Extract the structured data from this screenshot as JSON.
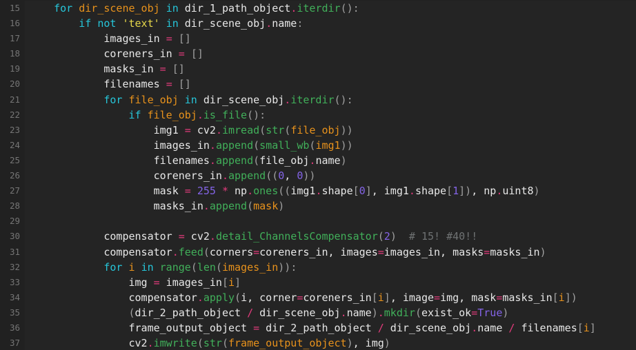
{
  "editor": {
    "language": "python",
    "theme": "dark",
    "background_color": "#212121",
    "gutter_color": "#212121",
    "code_background_color": "#242424",
    "first_line_number": 15,
    "last_line_number": 37,
    "colors": {
      "keyword": "#26c6da",
      "function": "#41b05a",
      "variable": "#e8921c",
      "number": "#8464e8",
      "string": "#e6d74a",
      "operator": "#e33b7c",
      "punctuation": "#a0a0a0",
      "comment": "#6f7273",
      "plain": "#e8e8e8",
      "lineno": "#757575"
    }
  },
  "lines": [
    {
      "number": "15",
      "text": "    for dir_scene_obj in dir_1_path_object.iterdir():",
      "tokens": [
        {
          "t": "    ",
          "c": "pl"
        },
        {
          "t": "for",
          "c": "kw"
        },
        {
          "t": " ",
          "c": "pl"
        },
        {
          "t": "dir_scene_obj",
          "c": "var"
        },
        {
          "t": " ",
          "c": "pl"
        },
        {
          "t": "in",
          "c": "kw"
        },
        {
          "t": " dir_1_path_object",
          "c": "pl"
        },
        {
          "t": ".",
          "c": "op"
        },
        {
          "t": "iterdir",
          "c": "fn"
        },
        {
          "t": "()",
          "c": "pn"
        },
        {
          "t": ":",
          "c": "pn"
        }
      ]
    },
    {
      "number": "16",
      "text": "        if not 'text' in dir_scene_obj.name:",
      "tokens": [
        {
          "t": "        ",
          "c": "pl"
        },
        {
          "t": "if",
          "c": "kw"
        },
        {
          "t": " ",
          "c": "pl"
        },
        {
          "t": "not",
          "c": "kw"
        },
        {
          "t": " ",
          "c": "pl"
        },
        {
          "t": "'text'",
          "c": "str"
        },
        {
          "t": " ",
          "c": "pl"
        },
        {
          "t": "in",
          "c": "kw"
        },
        {
          "t": " dir_scene_obj",
          "c": "pl"
        },
        {
          "t": ".",
          "c": "op"
        },
        {
          "t": "name",
          "c": "pl"
        },
        {
          "t": ":",
          "c": "pn"
        }
      ]
    },
    {
      "number": "17",
      "text": "            images_in = []",
      "tokens": [
        {
          "t": "            images_in",
          "c": "pl"
        },
        {
          "t": " ",
          "c": "pl"
        },
        {
          "t": "=",
          "c": "op"
        },
        {
          "t": " ",
          "c": "pl"
        },
        {
          "t": "[]",
          "c": "pn"
        }
      ]
    },
    {
      "number": "18",
      "text": "            coreners_in = []",
      "tokens": [
        {
          "t": "            coreners_in",
          "c": "pl"
        },
        {
          "t": " ",
          "c": "pl"
        },
        {
          "t": "=",
          "c": "op"
        },
        {
          "t": " ",
          "c": "pl"
        },
        {
          "t": "[]",
          "c": "pn"
        }
      ]
    },
    {
      "number": "19",
      "text": "            masks_in = []",
      "tokens": [
        {
          "t": "            masks_in",
          "c": "pl"
        },
        {
          "t": " ",
          "c": "pl"
        },
        {
          "t": "=",
          "c": "op"
        },
        {
          "t": " ",
          "c": "pl"
        },
        {
          "t": "[]",
          "c": "pn"
        }
      ]
    },
    {
      "number": "20",
      "text": "            filenames = []",
      "tokens": [
        {
          "t": "            filenames",
          "c": "pl"
        },
        {
          "t": " ",
          "c": "pl"
        },
        {
          "t": "=",
          "c": "op"
        },
        {
          "t": " ",
          "c": "pl"
        },
        {
          "t": "[]",
          "c": "pn"
        }
      ]
    },
    {
      "number": "21",
      "text": "            for file_obj in dir_scene_obj.iterdir():",
      "tokens": [
        {
          "t": "            ",
          "c": "pl"
        },
        {
          "t": "for",
          "c": "kw"
        },
        {
          "t": " ",
          "c": "pl"
        },
        {
          "t": "file_obj",
          "c": "var"
        },
        {
          "t": " ",
          "c": "pl"
        },
        {
          "t": "in",
          "c": "kw"
        },
        {
          "t": " dir_scene_obj",
          "c": "pl"
        },
        {
          "t": ".",
          "c": "op"
        },
        {
          "t": "iterdir",
          "c": "fn"
        },
        {
          "t": "()",
          "c": "pn"
        },
        {
          "t": ":",
          "c": "pn"
        }
      ]
    },
    {
      "number": "22",
      "text": "                if file_obj.is_file():",
      "tokens": [
        {
          "t": "                ",
          "c": "pl"
        },
        {
          "t": "if",
          "c": "kw"
        },
        {
          "t": " ",
          "c": "pl"
        },
        {
          "t": "file_obj",
          "c": "var"
        },
        {
          "t": ".",
          "c": "op"
        },
        {
          "t": "is_file",
          "c": "fn"
        },
        {
          "t": "()",
          "c": "pn"
        },
        {
          "t": ":",
          "c": "pn"
        }
      ]
    },
    {
      "number": "23",
      "text": "                    img1 = cv2.imread(str(file_obj))",
      "tokens": [
        {
          "t": "                    img1",
          "c": "pl"
        },
        {
          "t": " ",
          "c": "pl"
        },
        {
          "t": "=",
          "c": "op"
        },
        {
          "t": " cv2",
          "c": "pl"
        },
        {
          "t": ".",
          "c": "op"
        },
        {
          "t": "imread",
          "c": "fn"
        },
        {
          "t": "(",
          "c": "pn"
        },
        {
          "t": "str",
          "c": "fn"
        },
        {
          "t": "(",
          "c": "pn"
        },
        {
          "t": "file_obj",
          "c": "var"
        },
        {
          "t": "))",
          "c": "pn"
        }
      ]
    },
    {
      "number": "24",
      "text": "                    images_in.append(small_wb(img1))",
      "tokens": [
        {
          "t": "                    images_in",
          "c": "pl"
        },
        {
          "t": ".",
          "c": "op"
        },
        {
          "t": "append",
          "c": "fn"
        },
        {
          "t": "(",
          "c": "pn"
        },
        {
          "t": "small_wb",
          "c": "fn"
        },
        {
          "t": "(",
          "c": "pn"
        },
        {
          "t": "img1",
          "c": "var"
        },
        {
          "t": "))",
          "c": "pn"
        }
      ]
    },
    {
      "number": "25",
      "text": "                    filenames.append(file_obj.name)",
      "tokens": [
        {
          "t": "                    filenames",
          "c": "pl"
        },
        {
          "t": ".",
          "c": "op"
        },
        {
          "t": "append",
          "c": "fn"
        },
        {
          "t": "(",
          "c": "pn"
        },
        {
          "t": "file_obj",
          "c": "pl"
        },
        {
          "t": ".",
          "c": "op"
        },
        {
          "t": "name",
          "c": "pl"
        },
        {
          "t": ")",
          "c": "pn"
        }
      ]
    },
    {
      "number": "26",
      "text": "                    coreners_in.append((0, 0))",
      "tokens": [
        {
          "t": "                    coreners_in",
          "c": "pl"
        },
        {
          "t": ".",
          "c": "op"
        },
        {
          "t": "append",
          "c": "fn"
        },
        {
          "t": "((",
          "c": "pn"
        },
        {
          "t": "0",
          "c": "num"
        },
        {
          "t": ", ",
          "c": "pl"
        },
        {
          "t": "0",
          "c": "num"
        },
        {
          "t": "))",
          "c": "pn"
        }
      ]
    },
    {
      "number": "27",
      "text": "                    mask = 255 * np.ones((img1.shape[0], img1.shape[1]), np.uint8)",
      "tokens": [
        {
          "t": "                    mask",
          "c": "pl"
        },
        {
          "t": " ",
          "c": "pl"
        },
        {
          "t": "=",
          "c": "op"
        },
        {
          "t": " ",
          "c": "pl"
        },
        {
          "t": "255",
          "c": "num"
        },
        {
          "t": " ",
          "c": "pl"
        },
        {
          "t": "*",
          "c": "op"
        },
        {
          "t": " np",
          "c": "pl"
        },
        {
          "t": ".",
          "c": "op"
        },
        {
          "t": "ones",
          "c": "fn"
        },
        {
          "t": "((",
          "c": "pn"
        },
        {
          "t": "img1",
          "c": "pl"
        },
        {
          "t": ".",
          "c": "op"
        },
        {
          "t": "shape",
          "c": "pl"
        },
        {
          "t": "[",
          "c": "pn"
        },
        {
          "t": "0",
          "c": "num"
        },
        {
          "t": "]",
          "c": "pn"
        },
        {
          "t": ", img1",
          "c": "pl"
        },
        {
          "t": ".",
          "c": "op"
        },
        {
          "t": "shape",
          "c": "pl"
        },
        {
          "t": "[",
          "c": "pn"
        },
        {
          "t": "1",
          "c": "num"
        },
        {
          "t": "])",
          "c": "pn"
        },
        {
          "t": ", np",
          "c": "pl"
        },
        {
          "t": ".",
          "c": "op"
        },
        {
          "t": "uint8",
          "c": "pl"
        },
        {
          "t": ")",
          "c": "pn"
        }
      ]
    },
    {
      "number": "28",
      "text": "                    masks_in.append(mask)",
      "tokens": [
        {
          "t": "                    masks_in",
          "c": "pl"
        },
        {
          "t": ".",
          "c": "op"
        },
        {
          "t": "append",
          "c": "fn"
        },
        {
          "t": "(",
          "c": "pn"
        },
        {
          "t": "mask",
          "c": "var"
        },
        {
          "t": ")",
          "c": "pn"
        }
      ]
    },
    {
      "number": "29",
      "text": "",
      "tokens": []
    },
    {
      "number": "30",
      "text": "            compensator = cv2.detail_ChannelsCompensator(2)  # 15! #40!!",
      "tokens": [
        {
          "t": "            compensator",
          "c": "pl"
        },
        {
          "t": " ",
          "c": "pl"
        },
        {
          "t": "=",
          "c": "op"
        },
        {
          "t": " cv2",
          "c": "pl"
        },
        {
          "t": ".",
          "c": "op"
        },
        {
          "t": "detail_ChannelsCompensator",
          "c": "fn"
        },
        {
          "t": "(",
          "c": "pn"
        },
        {
          "t": "2",
          "c": "num"
        },
        {
          "t": ")",
          "c": "pn"
        },
        {
          "t": "  ",
          "c": "pl"
        },
        {
          "t": "# 15! #40!!",
          "c": "cmt"
        }
      ]
    },
    {
      "number": "31",
      "text": "            compensator.feed(corners=coreners_in, images=images_in, masks=masks_in)",
      "tokens": [
        {
          "t": "            compensator",
          "c": "pl"
        },
        {
          "t": ".",
          "c": "op"
        },
        {
          "t": "feed",
          "c": "fn"
        },
        {
          "t": "(",
          "c": "pn"
        },
        {
          "t": "corners",
          "c": "pl"
        },
        {
          "t": "=",
          "c": "op"
        },
        {
          "t": "coreners_in, images",
          "c": "pl"
        },
        {
          "t": "=",
          "c": "op"
        },
        {
          "t": "images_in, masks",
          "c": "pl"
        },
        {
          "t": "=",
          "c": "op"
        },
        {
          "t": "masks_in",
          "c": "pl"
        },
        {
          "t": ")",
          "c": "pn"
        }
      ]
    },
    {
      "number": "32",
      "text": "            for i in range(len(images_in)):",
      "tokens": [
        {
          "t": "            ",
          "c": "pl"
        },
        {
          "t": "for",
          "c": "kw"
        },
        {
          "t": " ",
          "c": "pl"
        },
        {
          "t": "i",
          "c": "var"
        },
        {
          "t": " ",
          "c": "pl"
        },
        {
          "t": "in",
          "c": "kw"
        },
        {
          "t": " ",
          "c": "pl"
        },
        {
          "t": "range",
          "c": "fn"
        },
        {
          "t": "(",
          "c": "pn"
        },
        {
          "t": "len",
          "c": "fn"
        },
        {
          "t": "(",
          "c": "pn"
        },
        {
          "t": "images_in",
          "c": "var"
        },
        {
          "t": "))",
          "c": "pn"
        },
        {
          "t": ":",
          "c": "pn"
        }
      ]
    },
    {
      "number": "33",
      "text": "                img = images_in[i]",
      "tokens": [
        {
          "t": "                img",
          "c": "pl"
        },
        {
          "t": " ",
          "c": "pl"
        },
        {
          "t": "=",
          "c": "op"
        },
        {
          "t": " images_in",
          "c": "pl"
        },
        {
          "t": "[",
          "c": "pn"
        },
        {
          "t": "i",
          "c": "var"
        },
        {
          "t": "]",
          "c": "pn"
        }
      ]
    },
    {
      "number": "34",
      "text": "                compensator.apply(i, corner=coreners_in[i], image=img, mask=masks_in[i])",
      "tokens": [
        {
          "t": "                compensator",
          "c": "pl"
        },
        {
          "t": ".",
          "c": "op"
        },
        {
          "t": "apply",
          "c": "fn"
        },
        {
          "t": "(",
          "c": "pn"
        },
        {
          "t": "i, corner",
          "c": "pl"
        },
        {
          "t": "=",
          "c": "op"
        },
        {
          "t": "coreners_in",
          "c": "pl"
        },
        {
          "t": "[",
          "c": "pn"
        },
        {
          "t": "i",
          "c": "var"
        },
        {
          "t": "]",
          "c": "pn"
        },
        {
          "t": ", image",
          "c": "pl"
        },
        {
          "t": "=",
          "c": "op"
        },
        {
          "t": "img, mask",
          "c": "pl"
        },
        {
          "t": "=",
          "c": "op"
        },
        {
          "t": "masks_in",
          "c": "pl"
        },
        {
          "t": "[",
          "c": "pn"
        },
        {
          "t": "i",
          "c": "var"
        },
        {
          "t": "])",
          "c": "pn"
        }
      ]
    },
    {
      "number": "35",
      "text": "                (dir_2_path_object / dir_scene_obj.name).mkdir(exist_ok=True)",
      "tokens": [
        {
          "t": "                ",
          "c": "pl"
        },
        {
          "t": "(",
          "c": "pn"
        },
        {
          "t": "dir_2_path_object",
          "c": "pl"
        },
        {
          "t": " ",
          "c": "pl"
        },
        {
          "t": "/",
          "c": "op"
        },
        {
          "t": " dir_scene_obj",
          "c": "pl"
        },
        {
          "t": ".",
          "c": "op"
        },
        {
          "t": "name",
          "c": "pl"
        },
        {
          "t": ")",
          "c": "pn"
        },
        {
          "t": ".",
          "c": "op"
        },
        {
          "t": "mkdir",
          "c": "fn"
        },
        {
          "t": "(",
          "c": "pn"
        },
        {
          "t": "exist_ok",
          "c": "pl"
        },
        {
          "t": "=",
          "c": "op"
        },
        {
          "t": "True",
          "c": "num"
        },
        {
          "t": ")",
          "c": "pn"
        }
      ]
    },
    {
      "number": "36",
      "text": "                frame_output_object = dir_2_path_object / dir_scene_obj.name / filenames[i]",
      "tokens": [
        {
          "t": "                frame_output_object",
          "c": "pl"
        },
        {
          "t": " ",
          "c": "pl"
        },
        {
          "t": "=",
          "c": "op"
        },
        {
          "t": " dir_2_path_object",
          "c": "pl"
        },
        {
          "t": " ",
          "c": "pl"
        },
        {
          "t": "/",
          "c": "op"
        },
        {
          "t": " dir_scene_obj",
          "c": "pl"
        },
        {
          "t": ".",
          "c": "op"
        },
        {
          "t": "name",
          "c": "pl"
        },
        {
          "t": " ",
          "c": "pl"
        },
        {
          "t": "/",
          "c": "op"
        },
        {
          "t": " filenames",
          "c": "pl"
        },
        {
          "t": "[",
          "c": "pn"
        },
        {
          "t": "i",
          "c": "var"
        },
        {
          "t": "]",
          "c": "pn"
        }
      ]
    },
    {
      "number": "37",
      "text": "                cv2.imwrite(str(frame_output_object), img)",
      "tokens": [
        {
          "t": "                cv2",
          "c": "pl"
        },
        {
          "t": ".",
          "c": "op"
        },
        {
          "t": "imwrite",
          "c": "fn"
        },
        {
          "t": "(",
          "c": "pn"
        },
        {
          "t": "str",
          "c": "fn"
        },
        {
          "t": "(",
          "c": "pn"
        },
        {
          "t": "frame_output_object",
          "c": "var"
        },
        {
          "t": ")",
          "c": "pn"
        },
        {
          "t": ", img",
          "c": "pl"
        },
        {
          "t": ")",
          "c": "pn"
        }
      ]
    }
  ]
}
